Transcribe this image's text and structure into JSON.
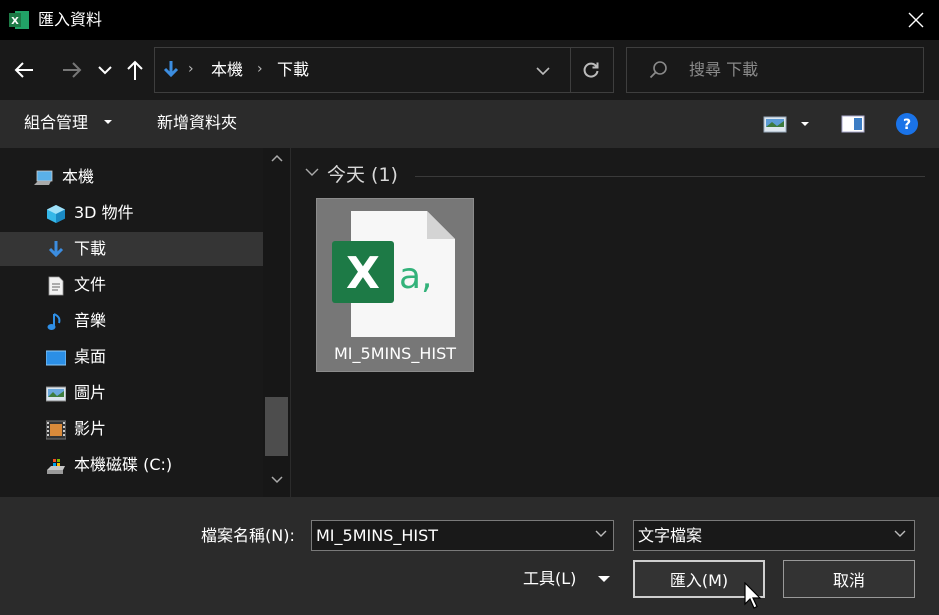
{
  "window": {
    "title": "匯入資料"
  },
  "address": {
    "crumbs": [
      "本機",
      "下載"
    ]
  },
  "search": {
    "placeholder": "搜尋 下載"
  },
  "toolbar": {
    "organize": "組合管理",
    "new_folder": "新增資料夾"
  },
  "sidebar": {
    "items": [
      {
        "label": "本機",
        "icon": "computer-icon"
      },
      {
        "label": "3D 物件",
        "icon": "cube-icon"
      },
      {
        "label": "下載",
        "icon": "download-icon",
        "selected": true
      },
      {
        "label": "文件",
        "icon": "document-icon"
      },
      {
        "label": "音樂",
        "icon": "music-icon"
      },
      {
        "label": "桌面",
        "icon": "desktop-icon"
      },
      {
        "label": "圖片",
        "icon": "pictures-icon"
      },
      {
        "label": "影片",
        "icon": "video-icon"
      },
      {
        "label": "本機磁碟 (C:)",
        "icon": "drive-icon"
      }
    ]
  },
  "content": {
    "group_title": "今天 (1)",
    "files": [
      {
        "name": "MI_5MINS_HIST",
        "icon": "excel-csv-file-icon",
        "selected": true
      }
    ]
  },
  "bottom": {
    "filename_label": "檔案名稱(N):",
    "filename_value": "MI_5MINS_HIST",
    "filetype_value": "文字檔案",
    "tools_label": "工具(L)",
    "import_label": "匯入(M)",
    "cancel_label": "取消"
  },
  "colors": {
    "excel_green": "#1d7a46",
    "help_blue": "#1a73e8",
    "accent_blue": "#3c8de0"
  }
}
